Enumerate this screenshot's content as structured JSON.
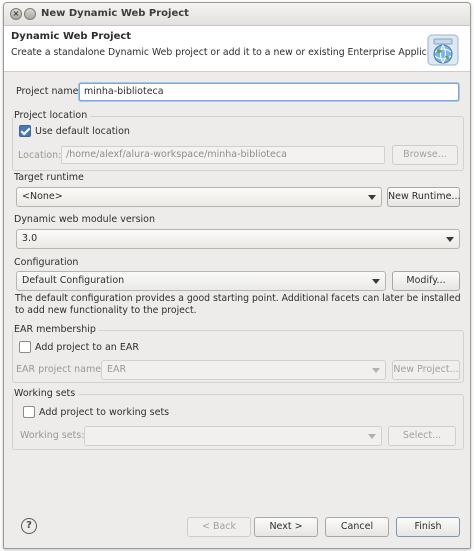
{
  "window": {
    "title": "New Dynamic Web Project"
  },
  "header": {
    "title": "Dynamic Web Project",
    "description": "Create a standalone Dynamic Web project or add it to a new or existing Enterprise Application."
  },
  "project_name": {
    "label": "Project name:",
    "value": "minha-biblioteca"
  },
  "project_location": {
    "title": "Project location",
    "use_default_label": "Use default location",
    "use_default_checked": true,
    "location_label": "Location:",
    "location_value": "/home/alexf/alura-workspace/minha-biblioteca",
    "browse_label": "Browse..."
  },
  "target_runtime": {
    "title": "Target runtime",
    "selected": "<None>",
    "new_runtime_label": "New Runtime..."
  },
  "module_version": {
    "title": "Dynamic web module version",
    "selected": "3.0"
  },
  "configuration": {
    "title": "Configuration",
    "selected": "Default Configuration",
    "modify_label": "Modify...",
    "description": "The default configuration provides a good starting point. Additional facets can later be installed to add new functionality to the project."
  },
  "ear": {
    "title": "EAR membership",
    "add_label": "Add project to an EAR",
    "add_checked": false,
    "project_name_label": "EAR project name:",
    "project_name_value": "EAR",
    "new_project_label": "New Project..."
  },
  "working_sets": {
    "title": "Working sets",
    "add_label": "Add project to working sets",
    "add_checked": false,
    "sets_label": "Working sets:",
    "select_label": "Select..."
  },
  "footer": {
    "help_icon": "?",
    "back_label": "< Back",
    "next_label": "Next >",
    "cancel_label": "Cancel",
    "finish_label": "Finish"
  },
  "titlebar_buttons": {
    "close": "×",
    "minimize": "–",
    "maximize": "□"
  }
}
